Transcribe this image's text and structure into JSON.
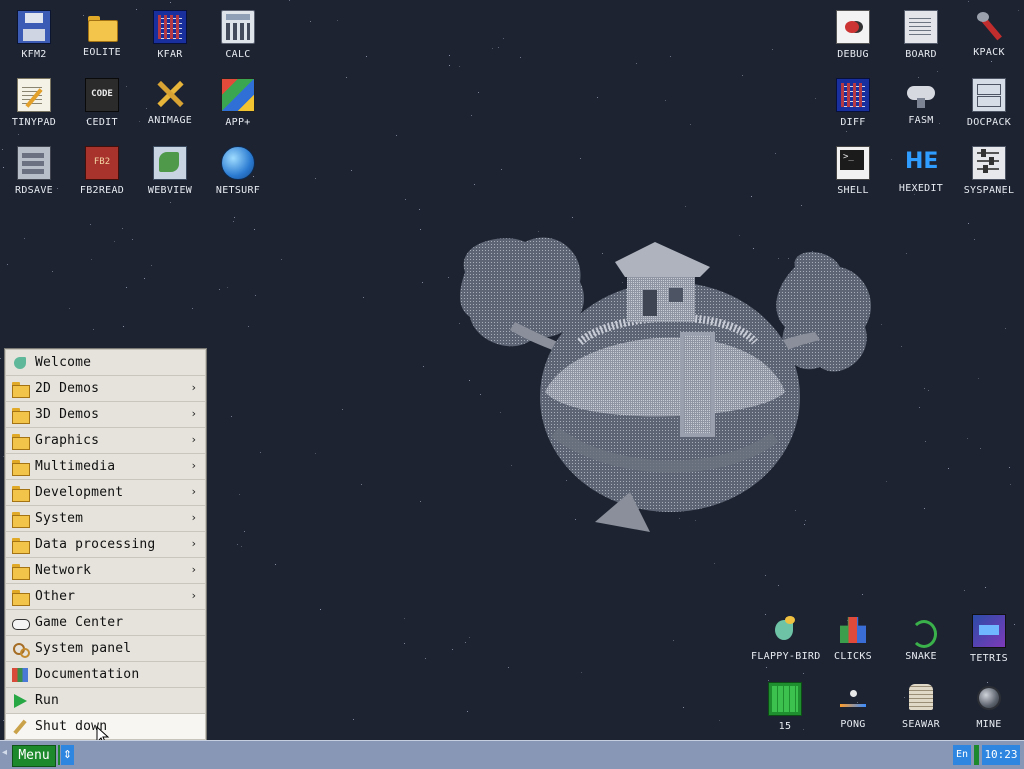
{
  "desktop": {
    "icons_left": [
      {
        "label": "KFM2",
        "icon": "floppy-icon"
      },
      {
        "label": "EOLITE",
        "icon": "folder-icon"
      },
      {
        "label": "KFAR",
        "icon": "grid-icon"
      },
      {
        "label": "CALC",
        "icon": "calculator-icon"
      },
      {
        "label": "TINYPAD",
        "icon": "notepad-icon"
      },
      {
        "label": "CEDIT",
        "icon": "code-icon",
        "badge": "CODE"
      },
      {
        "label": "ANIMAGE",
        "icon": "pencil-icon"
      },
      {
        "label": "APP+",
        "icon": "cube-icon"
      },
      {
        "label": "RDSAVE",
        "icon": "drives-icon"
      },
      {
        "label": "FB2READ",
        "icon": "book-icon",
        "badge": "FB2"
      },
      {
        "label": "WEBVIEW",
        "icon": "web-icon"
      },
      {
        "label": "NETSURF",
        "icon": "globe-icon"
      }
    ],
    "icons_right_top": [
      {
        "label": "DEBUG",
        "icon": "bugs-icon"
      },
      {
        "label": "BOARD",
        "icon": "board-icon"
      },
      {
        "label": "KPACK",
        "icon": "wrench-icon"
      },
      {
        "label": "DIFF",
        "icon": "diff-icon"
      },
      {
        "label": "FASM",
        "icon": "cloud-icon"
      },
      {
        "label": "DOCPACK",
        "icon": "cabinet-icon"
      },
      {
        "label": "SHELL",
        "icon": "terminal-icon"
      },
      {
        "label": "HEXEDIT",
        "icon": "hexedit-icon",
        "badge": "HE"
      },
      {
        "label": "SYSPANEL",
        "icon": "sliders-icon"
      }
    ],
    "icons_right_bottom": [
      {
        "label": "FLAPPY-BIRD",
        "icon": "bird-icon"
      },
      {
        "label": "CLICKS",
        "icon": "clicks-icon"
      },
      {
        "label": "SNAKE",
        "icon": "snake-icon"
      },
      {
        "label": "TETRIS",
        "icon": "tetris-icon"
      },
      {
        "label": "15",
        "icon": "fifteen-icon"
      },
      {
        "label": "PONG",
        "icon": "pong-icon"
      },
      {
        "label": "SEAWAR",
        "icon": "ship-icon"
      },
      {
        "label": "MINE",
        "icon": "mine-icon"
      }
    ]
  },
  "start_menu": {
    "items": [
      {
        "label": "Welcome",
        "icon": "bird-icon",
        "submenu": false
      },
      {
        "label": "2D Demos",
        "icon": "folder-icon",
        "submenu": true
      },
      {
        "label": "3D Demos",
        "icon": "folder-icon",
        "submenu": true
      },
      {
        "label": "Graphics",
        "icon": "folder-icon",
        "submenu": true
      },
      {
        "label": "Multimedia",
        "icon": "folder-icon",
        "submenu": true
      },
      {
        "label": "Development",
        "icon": "folder-icon",
        "submenu": true
      },
      {
        "label": "System",
        "icon": "folder-icon",
        "submenu": true
      },
      {
        "label": "Data processing",
        "icon": "folder-icon",
        "submenu": true
      },
      {
        "label": "Network",
        "icon": "folder-icon",
        "submenu": true
      },
      {
        "label": "Other",
        "icon": "folder-icon",
        "submenu": true
      },
      {
        "label": "Game Center",
        "icon": "gamepad-icon",
        "submenu": false
      },
      {
        "label": "System panel",
        "icon": "gears-icon",
        "submenu": false
      },
      {
        "label": "Documentation",
        "icon": "books-icon",
        "submenu": false
      },
      {
        "label": "Run",
        "icon": "play-icon",
        "submenu": false
      },
      {
        "label": "Shut down",
        "icon": "power-icon",
        "submenu": false
      }
    ],
    "submenu_arrow": "›"
  },
  "taskbar": {
    "left_arrow": "◂",
    "menu_label": "Menu",
    "updown": "⇕",
    "language": "En",
    "clock": "10:23"
  },
  "colors": {
    "desktop_bg": "#1d2331",
    "taskbar_bg": "#8797b5",
    "menu_button": "#1c8a2c",
    "accent_blue": "#2f86e0"
  }
}
